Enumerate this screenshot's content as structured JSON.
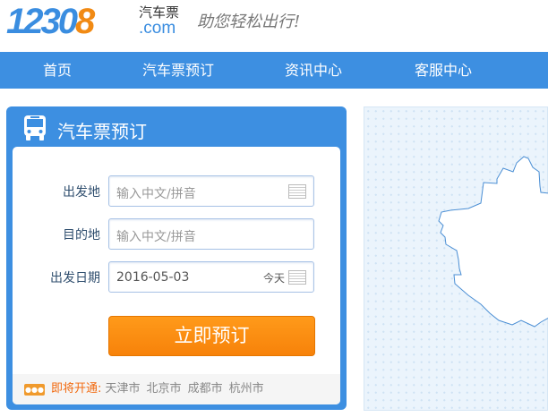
{
  "header": {
    "logo_main": "1230",
    "logo_accent": "8",
    "logo_text": "汽车票",
    "logo_domain": ".com",
    "slogan": "助您轻松出行!"
  },
  "nav": [
    {
      "label": "首页"
    },
    {
      "label": "汽车票预订"
    },
    {
      "label": "资讯中心"
    },
    {
      "label": "客服中心"
    }
  ],
  "booking": {
    "title": "汽车票预订",
    "icon": "bus-icon",
    "from": {
      "label": "出发地",
      "placeholder": "输入中文/拼音"
    },
    "to": {
      "label": "目的地",
      "placeholder": "输入中文/拼音"
    },
    "date": {
      "label": "出发日期",
      "value": "2016-05-03",
      "today": "今天"
    },
    "submit": "立即预订",
    "coming_soon": {
      "label": "即将开通:",
      "cities": [
        "天津市",
        "北京市",
        "成都市",
        "杭州市"
      ]
    }
  },
  "colors": {
    "brand_blue": "#3d8fe1",
    "accent_orange": "#f7820a"
  }
}
